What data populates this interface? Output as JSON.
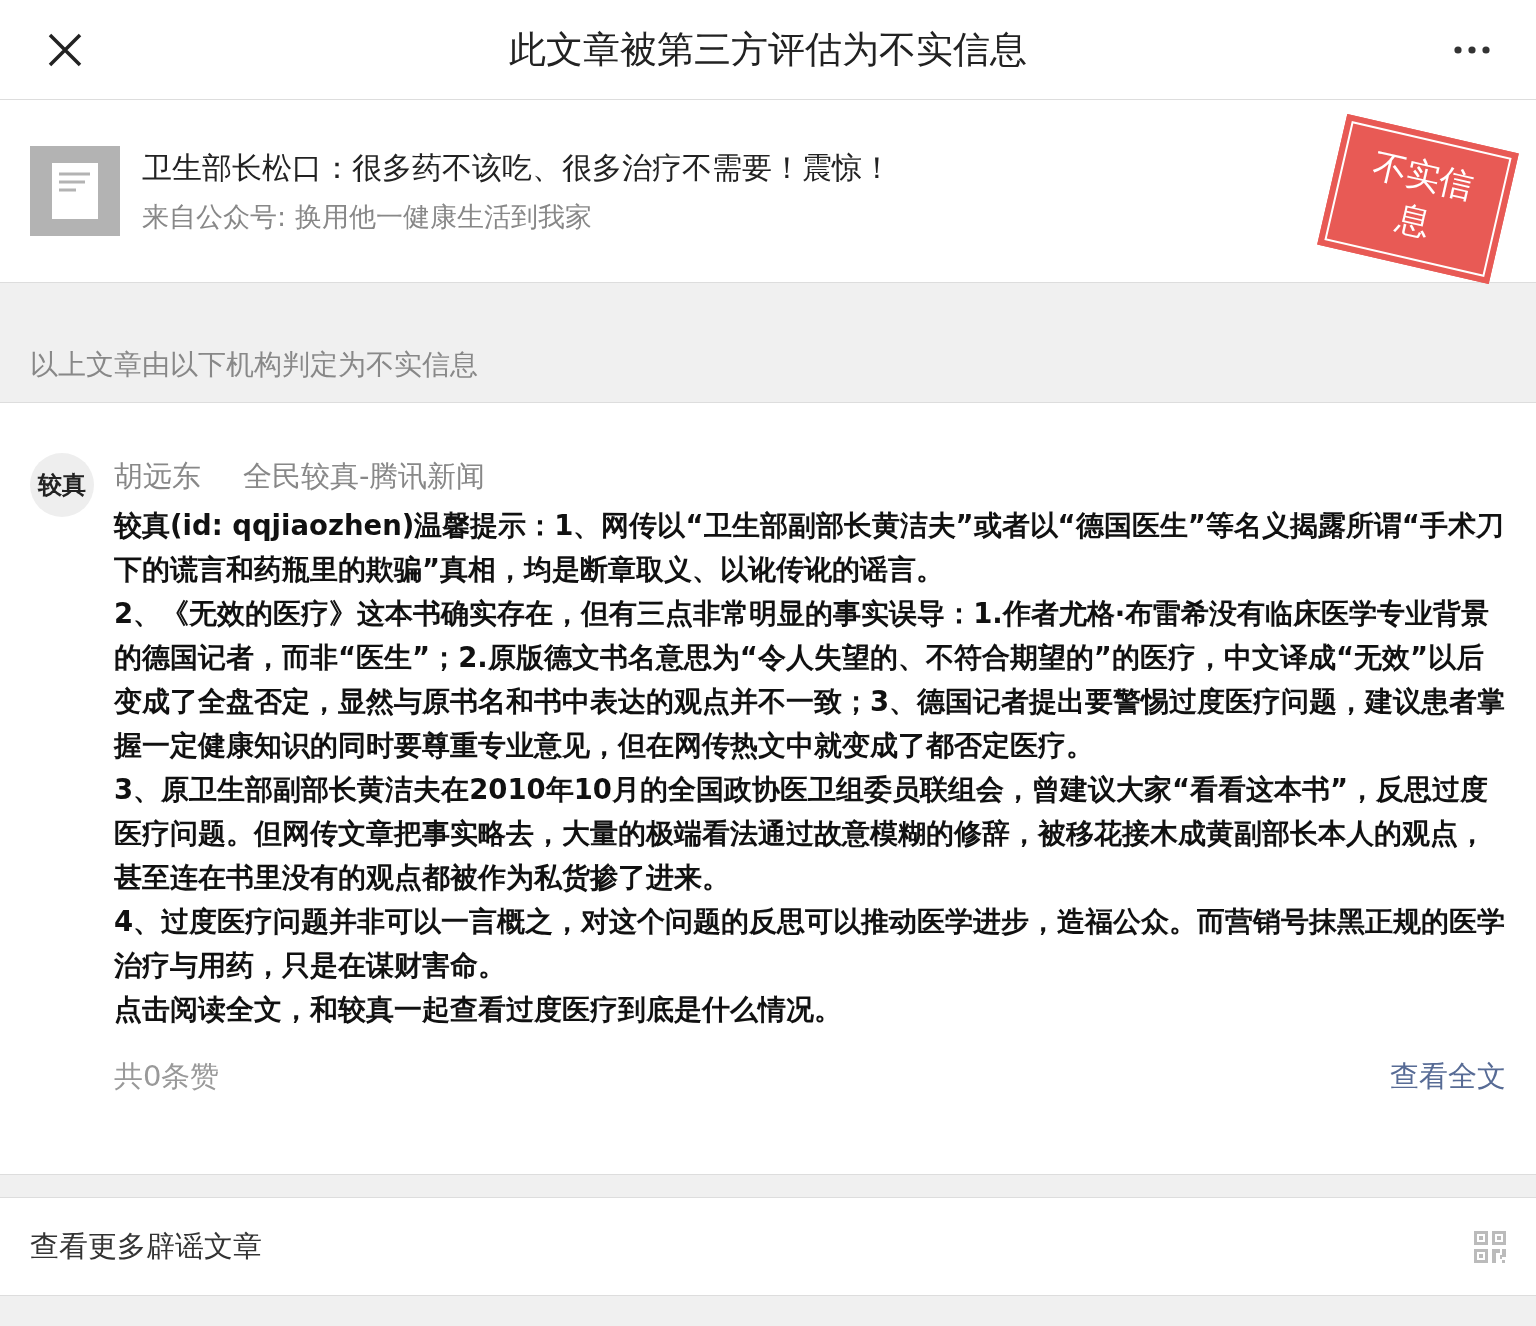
{
  "header": {
    "title": "此文章被第三方评估为不实信息"
  },
  "article": {
    "title": "卫生部长松口：很多药不该吃、很多治疗不需要！震惊！",
    "source": "来自公众号: 换用他一健康生活到我家",
    "stamp": "不实信息"
  },
  "section_label": "以上文章由以下机构判定为不实信息",
  "review": {
    "avatar_text": "较真",
    "author": "胡远东",
    "organization": "全民较真-腾讯新闻",
    "paragraphs": [
      "较真(id: qqjiaozhen)温馨提示：1、网传以“卫生部副部长黄洁夫”或者以“德国医生”等名义揭露所谓“手术刀下的谎言和药瓶里的欺骗”真相，均是断章取义、以讹传讹的谣言。",
      "2、《无效的医疗》这本书确实存在，但有三点非常明显的事实误导：1.作者尤格·布雷希没有临床医学专业背景的德国记者，而非“医生”；2.原版德文书名意思为“令人失望的、不符合期望的”的医疗，中文译成“无效”以后变成了全盘否定，显然与原书名和书中表达的观点并不一致；3、德国记者提出要警惕过度医疗问题，建议患者掌握一定健康知识的同时要尊重专业意见，但在网传热文中就变成了都否定医疗。",
      "3、原卫生部副部长黄洁夫在2010年10月的全国政协医卫组委员联组会，曾建议大家“看看这本书”，反思过度医疗问题。但网传文章把事实略去，大量的极端看法通过故意模糊的修辞，被移花接木成黄副部长本人的观点，甚至连在书里没有的观点都被作为私货掺了进来。",
      "4、过度医疗问题并非可以一言概之，对这个问题的反思可以推动医学进步，造福公众。而营销号抹黑正规的医学治疗与用药，只是在谋财害命。",
      "点击阅读全文，和较真一起查看过度医疗到底是什么情况。"
    ],
    "likes": "共0条赞",
    "read_full": "查看全文"
  },
  "more_link": "查看更多辟谣文章"
}
